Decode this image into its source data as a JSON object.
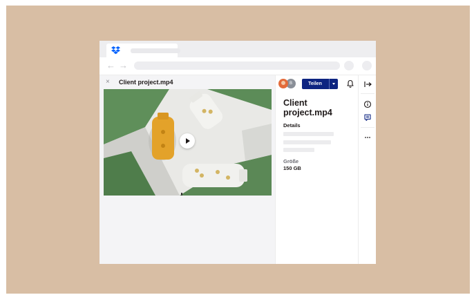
{
  "preview": {
    "close_label": "×",
    "file_title": "Client project.mp4"
  },
  "nav": {
    "back_arrow": "←",
    "forward_arrow": "→"
  },
  "info_panel": {
    "avatar_initial": "B",
    "share_label": "Teilen",
    "title": "Client project.mp4",
    "details_heading": "Details",
    "size_label": "Größe",
    "size_value": "150 GB"
  },
  "colors": {
    "backdrop": "#d8bea4",
    "share_button": "#0d2481",
    "dropbox_blue": "#0061fe",
    "bottle_yellow": "#e3a22a"
  },
  "icons": [
    "dropbox-logo-icon",
    "close-icon",
    "play-icon",
    "bell-icon",
    "collapse-panel-icon",
    "info-icon",
    "comment-icon",
    "more-icon"
  ]
}
